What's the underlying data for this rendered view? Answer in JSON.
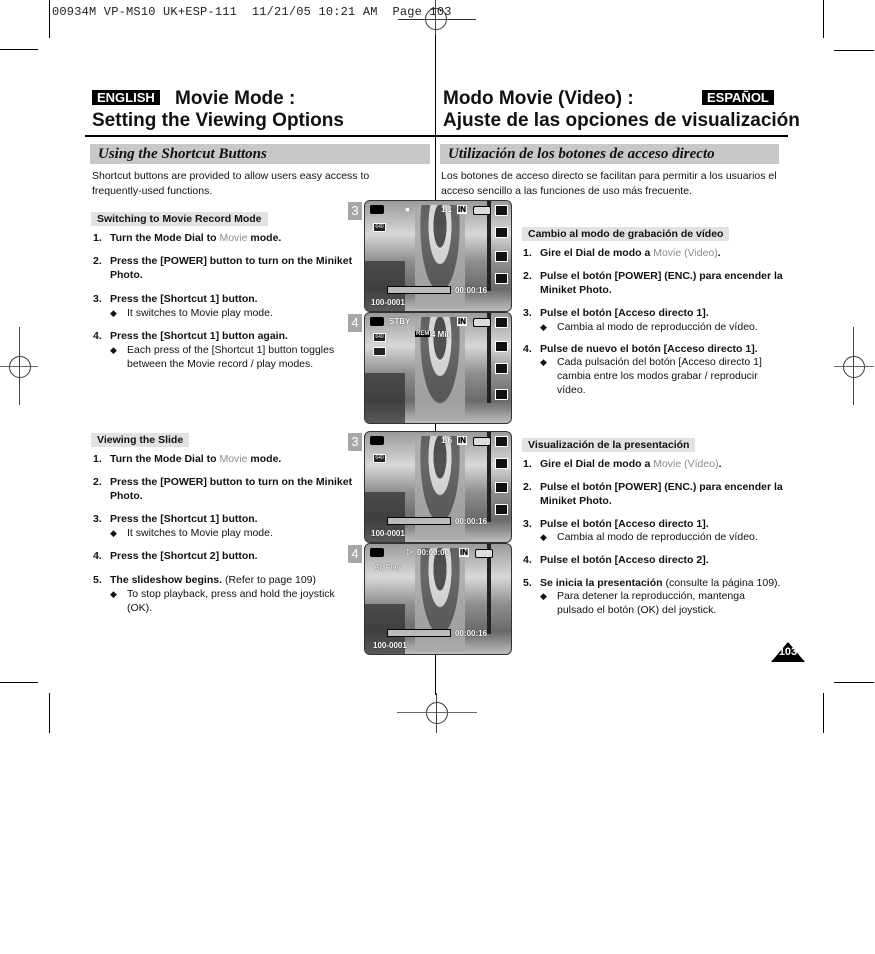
{
  "slug": "00934M VP-MS10 UK+ESP-111  11/21/05 10:21 AM  Page 103",
  "english": {
    "badge": "ENGLISH",
    "title_line1": "Movie Mode :",
    "title_line2": "Setting the Viewing Options",
    "section": "Using the Shortcut Buttons",
    "intro": "Shortcut buttons are provided to allow users easy access to frequently-used functions.",
    "switching": {
      "heading": "Switching to Movie Record Mode",
      "steps": [
        {
          "num": "1.",
          "pre": "Turn the Mode Dial to ",
          "highlight": "Movie",
          "post": " mode."
        },
        {
          "num": "2.",
          "text": "Press the [POWER] button to turn on the Miniket Photo."
        },
        {
          "num": "3.",
          "text": "Press the [Shortcut 1] button.",
          "bullet": "It switches to Movie play mode."
        },
        {
          "num": "4.",
          "text": "Press the [Shortcut 1] button again.",
          "bullet": "Each press of the [Shortcut 1] button toggles between the Movie record / play modes."
        }
      ]
    },
    "slide": {
      "heading": "Viewing the Slide",
      "steps": [
        {
          "num": "1.",
          "pre": "Turn the Mode Dial to ",
          "highlight": "Movie",
          "post": " mode."
        },
        {
          "num": "2.",
          "text": "Press the [POWER] button to turn on the Miniket Photo."
        },
        {
          "num": "3.",
          "text": "Press the [Shortcut 1] button.",
          "bullet": "It switches to Movie play mode."
        },
        {
          "num": "4.",
          "text": "Press the [Shortcut 2] button."
        },
        {
          "num": "5.",
          "bold": "The slideshow begins.",
          "normal": " (Refer to page 109)",
          "bullet": "To stop playback, press and hold the joystick (OK)."
        }
      ]
    }
  },
  "spanish": {
    "badge": "ESPAÑOL",
    "title_line1": "Modo Movie (Video) :",
    "title_line2": "Ajuste de las opciones de visualización",
    "section": "Utilización de los botones de acceso directo",
    "intro": "Los botones de acceso directo se facilitan para permitir a los usuarios el acceso sencillo a las funciones de uso más frecuente.",
    "switching": {
      "heading": "Cambio al modo de grabación de vídeo",
      "steps": [
        {
          "num": "1.",
          "pre": "Gire el Dial de modo a ",
          "highlight": "Movie (Video)",
          "post": "."
        },
        {
          "num": "2.",
          "text": "Pulse el botón [POWER] (ENC.) para encender la Miniket Photo."
        },
        {
          "num": "3.",
          "text": "Pulse el botón [Acceso directo 1].",
          "bullet": "Cambia al modo de reproducción de vídeo."
        },
        {
          "num": "4.",
          "text": "Pulse de nuevo el botón [Acceso directo 1].",
          "bullet": "Cada pulsación del botón [Acceso directo 1] cambia entre los modos grabar / reproducir vídeo."
        }
      ]
    },
    "slide": {
      "heading": "Visualización de la presentación",
      "steps": [
        {
          "num": "1.",
          "pre": "Gire el Dial de modo a ",
          "highlight": "Movie (Vídeo)",
          "post": "."
        },
        {
          "num": "2.",
          "text": "Pulse el botón [POWER] (ENC.) para encender la Miniket Photo."
        },
        {
          "num": "3.",
          "text": "Pulse el botón [Acceso directo 1].",
          "bullet": "Cambia al modo de reproducción de vídeo."
        },
        {
          "num": "4.",
          "text": "Pulse el botón [Acceso directo 2]."
        },
        {
          "num": "5.",
          "bold": "Se inicia la presentación",
          "normal": " (consulte la página 109).",
          "bullet": "Para detener la reproducción, mantenga pulsado el botón (OK) del joystick."
        }
      ]
    }
  },
  "screenshots": [
    {
      "step": "3",
      "file": "100-0001",
      "time": "00:00:16",
      "counter": "1/1",
      "memory": "IN",
      "top_indicator": "■"
    },
    {
      "step": "4",
      "status": "STBY",
      "remaining_label": "REM",
      "remaining": "4 Min",
      "memory": "IN"
    },
    {
      "step": "3",
      "file": "100-0001",
      "time": "00:00:16",
      "counter": "1/6",
      "memory": "IN",
      "top_indicator": "□"
    },
    {
      "step": "4",
      "mode": "All Play",
      "file": "100-0001",
      "time": "00:00:16",
      "play_time": "00:00:00",
      "memory": "IN"
    }
  ],
  "bullet_glyph": "◆",
  "page_number": "103"
}
